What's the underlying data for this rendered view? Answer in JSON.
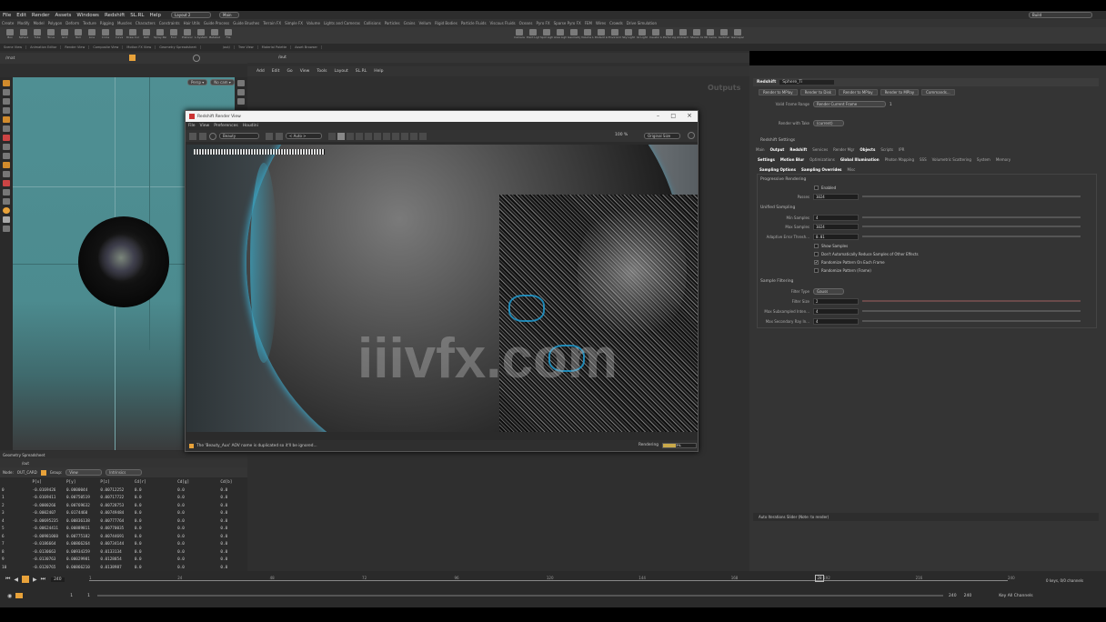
{
  "menubar": {
    "items": [
      "File",
      "Edit",
      "Render",
      "Assets",
      "Windows",
      "Redshift",
      "SL.RL",
      "Help"
    ],
    "desktop": "Layout 2",
    "build": "Main",
    "search": "Build"
  },
  "shelf_tabs": [
    "Create",
    "Modify",
    "Model",
    "Polygon",
    "Deform",
    "Texture",
    "Rigging",
    "Muscles",
    "Characters",
    "Constraints",
    "Hair Utils",
    "Guide Process",
    "Guide Brushes",
    "Terrain FX",
    "Simple FX",
    "Volume",
    "Lights and Cameras",
    "Collisions",
    "Particles",
    "Grains",
    "Vellum",
    "Rigid Bodies",
    "Particle Fluids",
    "Viscous Fluids",
    "Oceans",
    "Pyro FX",
    "Sparse Pyro FX",
    "FEM",
    "Wires",
    "Crowds",
    "Drive Simulation"
  ],
  "shelf_tools_left": [
    "Box",
    "Sphere",
    "Tube",
    "Torus",
    "Grid",
    "Null",
    "Line",
    "Circle",
    "Curve",
    "Draw Curve",
    "Path",
    "Spray Paint",
    "Font",
    "Platonic",
    "L-System",
    "Metaball",
    "File"
  ],
  "shelf_tools_right": [
    "Camera",
    "Point Light",
    "Spot Light",
    "Area Light",
    "Geometry Light",
    "Volume Light",
    "Distant Light",
    "Environment Light",
    "Sky Light",
    "GI Light",
    "Caustic Light",
    "Portal Light",
    "Ambient Light",
    "Stereo Camera",
    "VR Camera",
    "Switcher",
    "Gamepad Camera"
  ],
  "pane_tabs_left": [
    "Scene View",
    "Animation Editor",
    "Render View",
    "Composite View",
    "Motion FX View",
    "Geometry Spreadsheet"
  ],
  "pane_tabs_right": [
    "/out/",
    "Tree View",
    "Material Palette",
    "Asset Browser"
  ],
  "viewport": {
    "path": "/mat",
    "persp": "Persp ▾",
    "cam": "No cam ▾",
    "outputs_label": "Outputs"
  },
  "network": {
    "path": "/out",
    "menus": [
      "Add",
      "Edit",
      "Go",
      "View",
      "Tools",
      "Layout",
      "SL.RL",
      "Help"
    ]
  },
  "rv": {
    "title": "Redshift Render View",
    "menus": [
      "File",
      "View",
      "Preferences",
      "Houdini"
    ],
    "aov": "Beauty",
    "auto": "< Auto >",
    "zoom": "100 %",
    "size": "Original Size",
    "status": "The 'Beauty_Aux' AOV name is duplicated so it'll be ignored...",
    "rendering_label": "Rendering",
    "progress_text": "3%",
    "progress": 0.03,
    "watermark": "iiivfx.com"
  },
  "spreadsheet": {
    "title": "Geometry Spreadsheet",
    "node_label": "Node:",
    "node": "OUT_CARD",
    "group": "Group:",
    "view": "View",
    "intrinsics": "Intrinsics",
    "columns": [
      "",
      "P[x]",
      "P[y]",
      "P[z]",
      "Cd[r]",
      "Cd[g]",
      "Cd[b]"
    ],
    "rows": [
      [
        "0",
        "-0.0169426",
        "0.0000044",
        "0.00712252",
        "0.0",
        "0.0",
        "0.0"
      ],
      [
        "1",
        "-0.0169411",
        "0.00750519",
        "0.00717722",
        "0.0",
        "0.0",
        "0.0"
      ],
      [
        "2",
        "-0.0000266",
        "0.00769632",
        "0.00728753",
        "0.0",
        "0.0",
        "0.0"
      ],
      [
        "3",
        "-0.0002407",
        "0.0174460",
        "0.00749484",
        "0.0",
        "0.0",
        "0.0"
      ],
      [
        "4",
        "-0.00695235",
        "0.00836138",
        "0.00777764",
        "0.0",
        "0.0",
        "0.0"
      ],
      [
        "5",
        "-0.00624411",
        "0.00889811",
        "0.00770035",
        "0.0",
        "0.0",
        "0.0"
      ],
      [
        "6",
        "-0.00981060",
        "0.00775182",
        "0.00744691",
        "0.0",
        "0.0",
        "0.0"
      ],
      [
        "7",
        "-0.0186664",
        "0.00866264",
        "0.00734144",
        "0.0",
        "0.0",
        "0.0"
      ],
      [
        "8",
        "-0.0130663",
        "0.00934359",
        "0.0133134",
        "0.0",
        "0.0",
        "0.0"
      ],
      [
        "9",
        "-0.0130763",
        "0.00029981",
        "0.0128854",
        "0.0",
        "0.0",
        "0.0"
      ],
      [
        "10",
        "-0.0120765",
        "0.00866210",
        "0.0138987",
        "0.0",
        "0.0",
        "0.0"
      ]
    ]
  },
  "params": {
    "node_type": "Redshift",
    "node_name": "Sphere_Ti",
    "buttons": [
      "Render to MPlay",
      "Render to Disk",
      "Render to MPlay",
      "Render to MPlay",
      "Commands..."
    ],
    "valid_frame_label": "Valid Frame Range",
    "valid_frame": "Render Current Frame",
    "valid_frame_num": "1",
    "render_take_label": "Render with Take",
    "render_take": "(current)",
    "settings_label": "Redshift Settings",
    "tabs1": [
      "Main",
      "Output",
      "Redshift",
      "Services",
      "Render Mgr",
      "Objects",
      "Scripts",
      "IPR"
    ],
    "tabs2": [
      "Settings",
      "Motion Blur",
      "Optimizations",
      "Global Illumination",
      "Photon Mapping",
      "SSS",
      "Volumetric Scattering",
      "System",
      "Memory"
    ],
    "tabs3": [
      "Sampling Options",
      "Sampling Overrides",
      "Misc"
    ],
    "progressive_label": "Progressive Rendering",
    "enabled_label": "Enabled",
    "passes_label": "Passes",
    "passes": "1024",
    "unified_label": "Unified Sampling",
    "min_samples_label": "Min Samples",
    "min_samples": "4",
    "max_samples_label": "Max Samples",
    "max_samples": "1024",
    "adaptive_label": "Adaptive Error Thresh...",
    "adaptive": "0.01",
    "chk_show": "Show Samples",
    "chk_auto": "Don't Automatically Reduce Samples of Other Effects",
    "chk_random": "Randomize Pattern On Each Frame",
    "chk_rand2": "Randomize Pattern (Frame)",
    "filter_label": "Sample Filtering",
    "filter_type_label": "Filter Type",
    "filter_type": "Gauss",
    "filter_size_label": "Filter Size",
    "filter_size": "2",
    "max_sub_label": "Max Subsampled Inten...",
    "max_sub": "4",
    "max_second_label": "Max Secondary Ray In...",
    "max_second": "4",
    "help_text": "Auto Iterations Slider (Note: to render)"
  },
  "timeline": {
    "frame": "240",
    "start": "1",
    "start2": "1",
    "end": "240",
    "end2": "240",
    "ticks": [
      "1",
      "24",
      "48",
      "72",
      "96",
      "120",
      "144",
      "168",
      "192",
      "216",
      "240"
    ],
    "keys_label": "0 keys, 0/0 channels",
    "key_all": "Key All Channels",
    "current_marker": "28"
  },
  "colors": {
    "viewport_bg": "#4f8f93",
    "accent": "#e8a23a",
    "bg": "#333333"
  }
}
